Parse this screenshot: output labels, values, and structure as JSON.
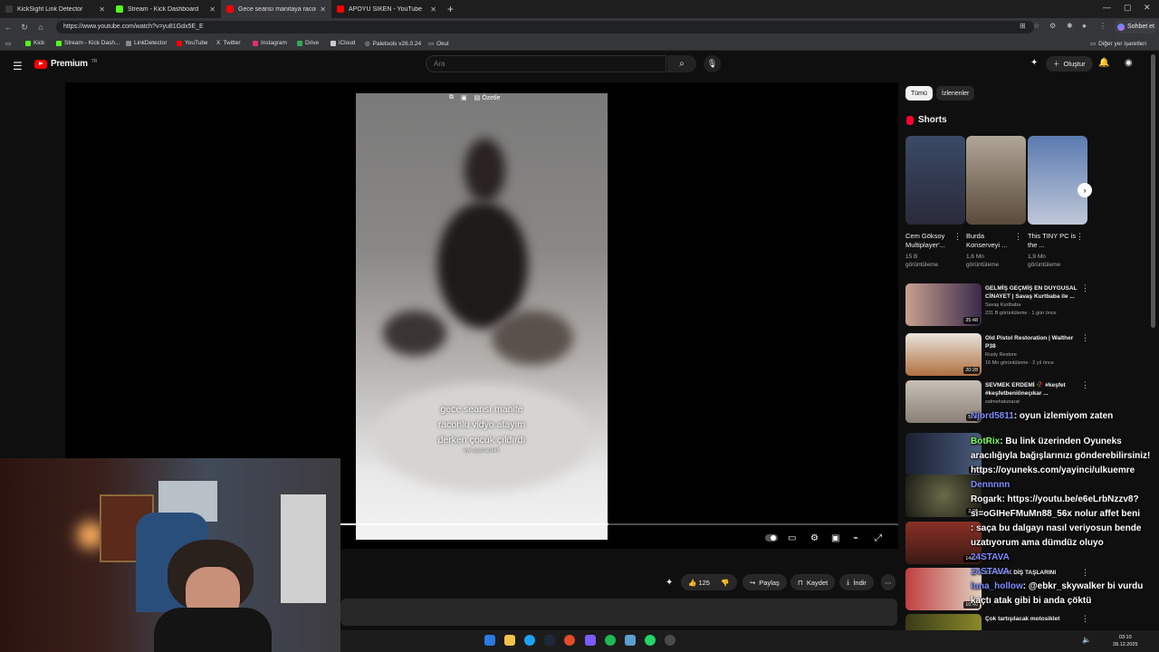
{
  "browser": {
    "tabs": [
      {
        "label": "KickSight Link Detector",
        "active": false,
        "color": "#3a3a3a"
      },
      {
        "label": "Stream - Kick Dashboard",
        "active": false,
        "color": "#53fc18"
      },
      {
        "label": "Gece seansı manitaya raconlu",
        "active": true,
        "color": "#ff0000"
      },
      {
        "label": "APOYU SİKEN - YouTube",
        "active": false,
        "color": "#ff0000"
      }
    ],
    "url": "https://www.youtube.com/watch?v=yu81Gdx5E_E",
    "chat_button": "Sohbet et",
    "bookmarks": [
      {
        "label": "Kick",
        "color": "#53fc18"
      },
      {
        "label": "Stream - Kick Dash...",
        "color": "#53fc18"
      },
      {
        "label": "LinkDetector",
        "color": "#888888"
      },
      {
        "label": "YouTube",
        "color": "#ff0000"
      },
      {
        "label": "Twitter",
        "color": "#dddddd"
      },
      {
        "label": "Instagram",
        "color": "#e1306c"
      },
      {
        "label": "Drive",
        "color": "#34a853"
      },
      {
        "label": "iCloud",
        "color": "#cccccc"
      },
      {
        "label": "Paletools v26.0.24",
        "color": "#cccccc"
      },
      {
        "label": "Okul",
        "color": "#cccccc"
      }
    ],
    "other_bookmarks": "Diğer yer işaretleri"
  },
  "youtube": {
    "logo_word": "Premium",
    "logo_region": "TR",
    "search_placeholder": "Ara",
    "create_label": "Oluştur",
    "video": {
      "summarize_label": "Özetle",
      "caption_lines": [
        "gece seansı manite",
        "raconlu vidyo atayım",
        "derken çocuk çıldırdı"
      ],
      "caption_small": "kyk-pişmanlık!!",
      "progress": 0.48
    },
    "actions": {
      "like_count": "125",
      "share": "Paylaş",
      "save": "Kaydet",
      "download": "İndir"
    },
    "chips": [
      "Tümü",
      "İzlenenler"
    ],
    "shorts_title": "Shorts",
    "shorts": [
      {
        "title": "Cem Göksoy Multiplayer'...",
        "views": "15 B görüntüleme",
        "color": "#2a3a55"
      },
      {
        "title": "Burda Konserveyi ...",
        "views": "1,6 Mn görüntüleme",
        "color": "#7a6a5a"
      },
      {
        "title": "This TINY PC is the ...",
        "views": "1,9 Mn görüntüleme",
        "color": "#3a4e7a"
      }
    ],
    "recommendations": [
      {
        "title": "GELMİŞ GEÇMİŞ EN DUYGUSAL CİNAYET | Savaş Kurtbaba ile ...",
        "channel": "Savaş Kurtbaba",
        "meta": "231 B görüntüleme · 1 gün önce",
        "duration": "35:48",
        "color": "#6a3a4a"
      },
      {
        "title": "Old Pistol Restoration | Walther P38",
        "channel": "Rusty Restore",
        "meta": "16 Mn görüntüleme · 2 yıl önce",
        "duration": "20:28",
        "color": "#a06a40"
      },
      {
        "title": "SEVMEK ERDEMİ 🥀 #keşfet #keşfetbeniöneçıkar ...",
        "channel": "salmehatunarat",
        "meta": "",
        "duration": "5:13",
        "color": "#b8b0a6"
      },
      {
        "title": "",
        "channel": "",
        "meta": "",
        "duration": "2:3",
        "color": "#1a2236"
      },
      {
        "title": "",
        "channel": "",
        "meta": "",
        "duration": "2:26",
        "color": "#30302a"
      },
      {
        "title": "",
        "channel": "",
        "meta": "",
        "duration": "14:42",
        "color": "#7a2a22"
      },
      {
        "title": "12 YILLIK DİŞ TAŞLARINI",
        "channel": "",
        "meta": "",
        "duration": "10:46",
        "color": "#9a3a3a"
      },
      {
        "title": "Çok tartışılacak motosiklet",
        "channel": "",
        "meta": "",
        "duration": "",
        "color": "#5a5a22"
      }
    ]
  },
  "chat": [
    {
      "name": "Njord5811",
      "text": ": oyun izlemiyom zaten",
      "name_style": "blue"
    },
    {
      "name": "",
      "text": "",
      "name_style": "blue"
    },
    {
      "name": "BotRix",
      "text": ": Bu link üzerinden Oyuneks aracılığıyla bağışlarınızı gönderebilirsiniz! https://oyuneks.com/yayinci/ulkuemre",
      "name_style": "green"
    },
    {
      "name": "Dennnnn",
      "text": "",
      "name_style": "blue"
    },
    {
      "name": "Rogark",
      "text": ": https://youtu.be/e6eLrbNzzv8?si=oGIHeFMuMn88_56x nolur affet beni",
      "name_style": "white"
    },
    {
      "name": "",
      "text": ": saça bu dalgayı nasıl veriyosun bende uzatıyorum ama dümdüz oluyo",
      "name_style": "blue"
    },
    {
      "name": "24STAVA",
      "text": "",
      "name_style": "blue"
    },
    {
      "name": "24STAVA",
      "text": "",
      "name_style": "blue"
    },
    {
      "name": "luna_hollow",
      "text": ": @ebkr_skywalker bi vurdu kaçtı atak gibi bi anda çöktü",
      "name_style": "blue"
    }
  ],
  "taskbar": {
    "time": "03:10",
    "date": "28.12.2025",
    "apps": [
      "#2a7ae2",
      "#f2c14e",
      "#1da1f2",
      "#0078d4",
      "#e34c26",
      "#7b5cff",
      "#1db954",
      "#25d366",
      "#5865f2",
      "#888888"
    ]
  }
}
